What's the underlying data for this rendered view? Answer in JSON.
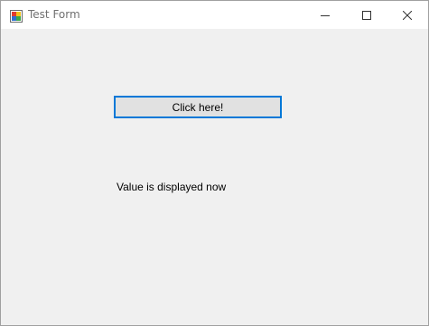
{
  "window": {
    "title": "Test Form",
    "app_icon": "winforms-app-icon",
    "controls": {
      "minimize_icon": "minimize-icon",
      "maximize_icon": "maximize-icon",
      "close_icon": "close-icon"
    }
  },
  "form": {
    "button_label": "Click here!",
    "value_label": "Value is displayed now"
  },
  "colors": {
    "focus_border": "#0078d7",
    "button_face": "#e1e1e1",
    "client_background": "#f0f0f0",
    "title_text": "#707070"
  }
}
